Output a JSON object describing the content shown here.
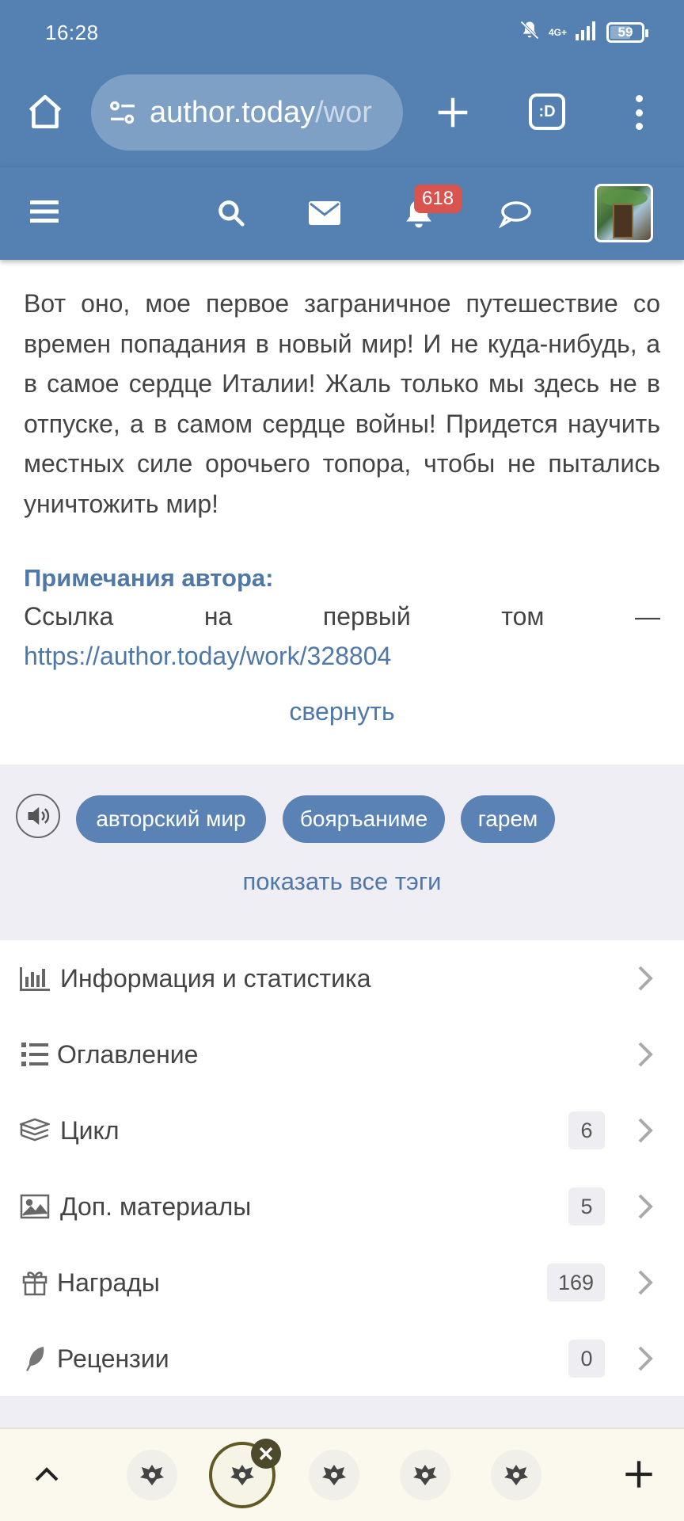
{
  "status_bar": {
    "time": "16:28",
    "battery": "59",
    "network": "4G+"
  },
  "browser": {
    "url_domain": "author.today",
    "url_path": "/wor",
    "tabs_label": ":D"
  },
  "site_header": {
    "notifications_count": "618"
  },
  "description": "Вот оно, мое первое заграничное путешествие со времен попадания в новый мир! И не куда-нибудь, а в самое сердце Италии! Жаль только мы здесь не в отпуске, а в самом сердце войны! Придется научить местных силе орочьего топора, чтобы не пытались уничтожить мир!",
  "notes": {
    "title": "Примечания автора:",
    "line_words": [
      "Ссылка",
      "на",
      "первый",
      "том",
      "—"
    ],
    "link": "https://author.today/work/328804",
    "collapse": "свернуть"
  },
  "tags": {
    "items": [
      "авторский мир",
      "бояръаниме",
      "гарем"
    ],
    "show_all": "показать все тэги"
  },
  "menu": [
    {
      "label": "Информация и статистика",
      "icon": "stats-icon",
      "count": ""
    },
    {
      "label": "Оглавление",
      "icon": "list-icon",
      "count": ""
    },
    {
      "label": "Цикл",
      "icon": "books-icon",
      "count": "6"
    },
    {
      "label": "Доп. материалы",
      "icon": "image-icon",
      "count": "5"
    },
    {
      "label": "Награды",
      "icon": "gift-icon",
      "count": "169"
    },
    {
      "label": "Рецензии",
      "icon": "feather-icon",
      "count": "0"
    }
  ],
  "colors": {
    "chrome": "#5480b2",
    "accent": "#4f77a7",
    "tag": "#5b82b4",
    "badge": "#d9534f"
  }
}
